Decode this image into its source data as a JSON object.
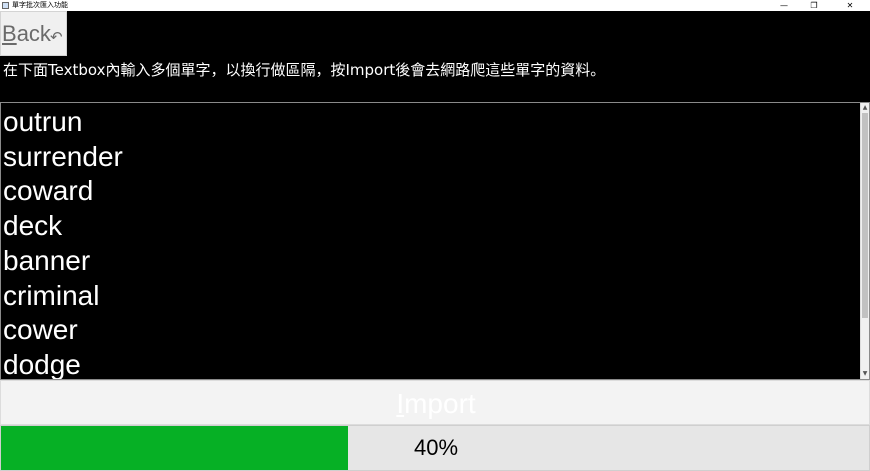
{
  "window": {
    "title": "單字批次匯入功能",
    "minimize_glyph": "—",
    "maximize_glyph": "❐",
    "close_glyph": "✕"
  },
  "back_button": {
    "label_first": "B",
    "label_rest": "ack",
    "icon": "undo-arrow-icon",
    "icon_glyph": "↶"
  },
  "instruction": "在下面Textbox內輸入多個單字，以換行做區隔，按Import後會去網路爬這些單字的資料。",
  "words": [
    "outrun",
    "surrender",
    "coward",
    "deck",
    "banner",
    "criminal",
    "cower",
    "dodge"
  ],
  "scrollbar": {
    "up_glyph": "▲",
    "down_glyph": "▼"
  },
  "import_button": {
    "label_first": "I",
    "label_rest": "mport"
  },
  "progress": {
    "value": 40,
    "label": "40%",
    "fill_color": "#06b025"
  }
}
